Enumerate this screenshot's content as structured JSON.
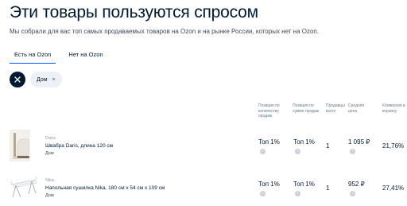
{
  "page": {
    "title": "Эти товары пользуются спросом",
    "subtitle": "Мы собрали для вас топ самых продаваемых товаров на Ozon и на рынке России, которых нет на Ozon."
  },
  "tabs": [
    {
      "label": "Есть на Ozon",
      "active": true
    },
    {
      "label": "Нет на Ozon",
      "active": false
    }
  ],
  "filters": {
    "clear_icon": "×",
    "chips": [
      {
        "label": "Дом",
        "close_icon": "×"
      }
    ]
  },
  "table": {
    "headers": {
      "position_qty": "Позиция по количеству продаж",
      "position_sum": "Позиция по сумме продаж",
      "sellers_count": "Продавцы всего",
      "avg_price": "Средняя цена",
      "conversion": "Конверсия в корзину"
    },
    "info_icon": "i",
    "rows": [
      {
        "brand": "Daris",
        "name": "Швабра Daris, длина 120 см",
        "category": "Дом",
        "position_qty": "Топ 1%",
        "position_sum": "Топ 1%",
        "sellers_count": "1",
        "avg_price": "1 095 ₽",
        "conversion": "21,76%"
      },
      {
        "brand": "Nika",
        "name": "Напольная сушилка Nika, 180 см х 54 см х 109 см",
        "category": "Дом",
        "position_qty": "Топ 1%",
        "position_sum": "Топ 1%",
        "sellers_count": "1",
        "avg_price": "952 ₽",
        "conversion": "27,41%"
      }
    ]
  },
  "colors": {
    "accent": "#005bff",
    "text": "#001a34",
    "chip_bg": "#edf0f4"
  }
}
